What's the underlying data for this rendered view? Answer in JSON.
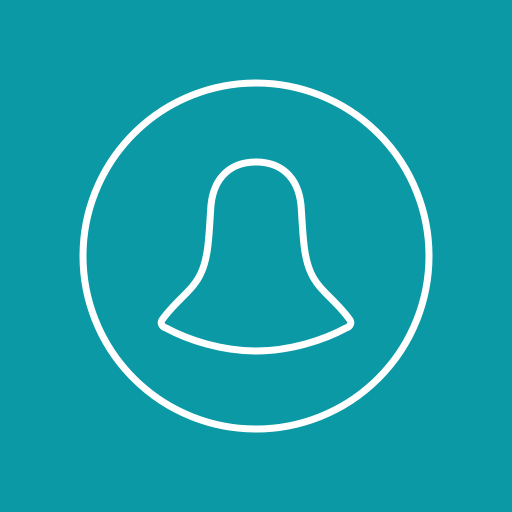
{
  "icon": {
    "name": "bell-icon",
    "background_color": "#0a99a5",
    "stroke_color": "#ffffff"
  }
}
